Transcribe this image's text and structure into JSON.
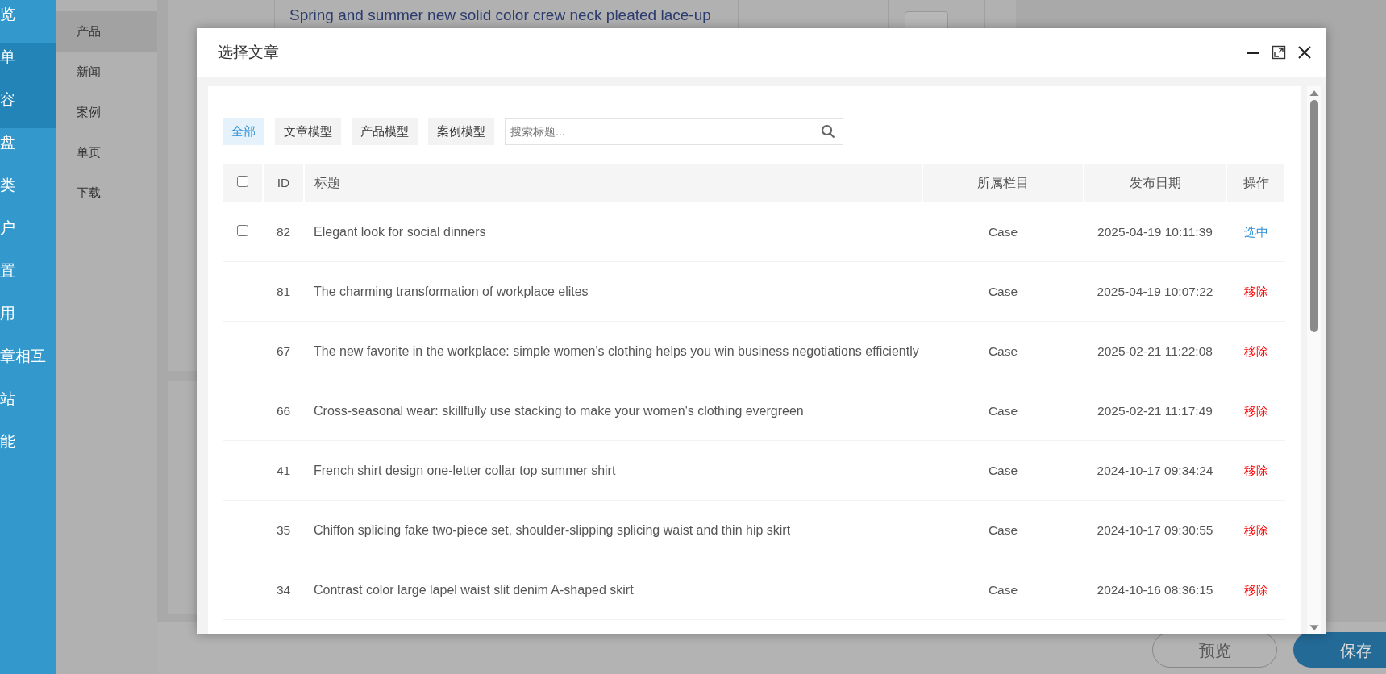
{
  "sidebar": {
    "items": [
      {
        "label": "览",
        "selected": false
      },
      {
        "label": "单",
        "selected": true
      },
      {
        "label": "容",
        "selected": true
      },
      {
        "label": "盘",
        "selected": false
      },
      {
        "label": "类",
        "selected": false
      },
      {
        "label": "户",
        "selected": false
      },
      {
        "label": "置",
        "selected": false
      },
      {
        "label": "用",
        "selected": false
      },
      {
        "label": "章相互",
        "selected": false
      },
      {
        "label": "站",
        "selected": false
      },
      {
        "label": "能",
        "selected": false
      }
    ]
  },
  "submenu": {
    "items": [
      {
        "label": "产品",
        "selected": true
      },
      {
        "label": "新闻",
        "selected": false
      },
      {
        "label": "案例",
        "selected": false
      },
      {
        "label": "单页",
        "selected": false
      },
      {
        "label": "下载",
        "selected": false
      }
    ]
  },
  "background_table": {
    "row": {
      "title": "Spring and summer new solid color crew neck pleated lace-up"
    }
  },
  "footer_buttons": [
    {
      "label": "预览",
      "kind": "outline"
    },
    {
      "label": "保存",
      "kind": "primary"
    }
  ],
  "dialog": {
    "title": "选择文章",
    "filters": [
      {
        "label": "全部",
        "selected": true
      },
      {
        "label": "文章模型",
        "selected": false
      },
      {
        "label": "产品模型",
        "selected": false
      },
      {
        "label": "案例模型",
        "selected": false
      }
    ],
    "search": {
      "placeholder": "搜索标题..."
    },
    "table": {
      "select_all_checked": false,
      "columns": [
        "ID",
        "标题",
        "所属栏目",
        "发布日期",
        "操作"
      ],
      "rows": [
        {
          "id": "82",
          "title": "Elegant look for social dinners",
          "category": "Case",
          "date": "2025-04-19 10:11:39",
          "action": "选中",
          "selected": false,
          "checked": false
        },
        {
          "id": "81",
          "title": "The charming transformation of workplace elites",
          "category": "Case",
          "date": "2025-04-19 10:07:22",
          "action": "移除",
          "selected": true
        },
        {
          "id": "67",
          "title": "The new favorite in the workplace: simple women's clothing helps you win business negotiations efficiently",
          "category": "Case",
          "date": "2025-02-21 11:22:08",
          "action": "移除",
          "selected": true
        },
        {
          "id": "66",
          "title": "Cross-seasonal wear: skillfully use stacking to make your women's clothing evergreen",
          "category": "Case",
          "date": "2025-02-21 11:17:49",
          "action": "移除",
          "selected": true
        },
        {
          "id": "41",
          "title": "French shirt design one-letter collar top summer shirt",
          "category": "Case",
          "date": "2024-10-17 09:34:24",
          "action": "移除",
          "selected": true
        },
        {
          "id": "35",
          "title": "Chiffon splicing fake two-piece set, shoulder-slipping splicing waist and thin hip skirt",
          "category": "Case",
          "date": "2024-10-17 09:30:55",
          "action": "移除",
          "selected": true
        },
        {
          "id": "34",
          "title": "Contrast color large lapel waist slit denim A-shaped skirt",
          "category": "Case",
          "date": "2024-10-16 08:36:15",
          "action": "移除",
          "selected": true
        }
      ]
    }
  }
}
